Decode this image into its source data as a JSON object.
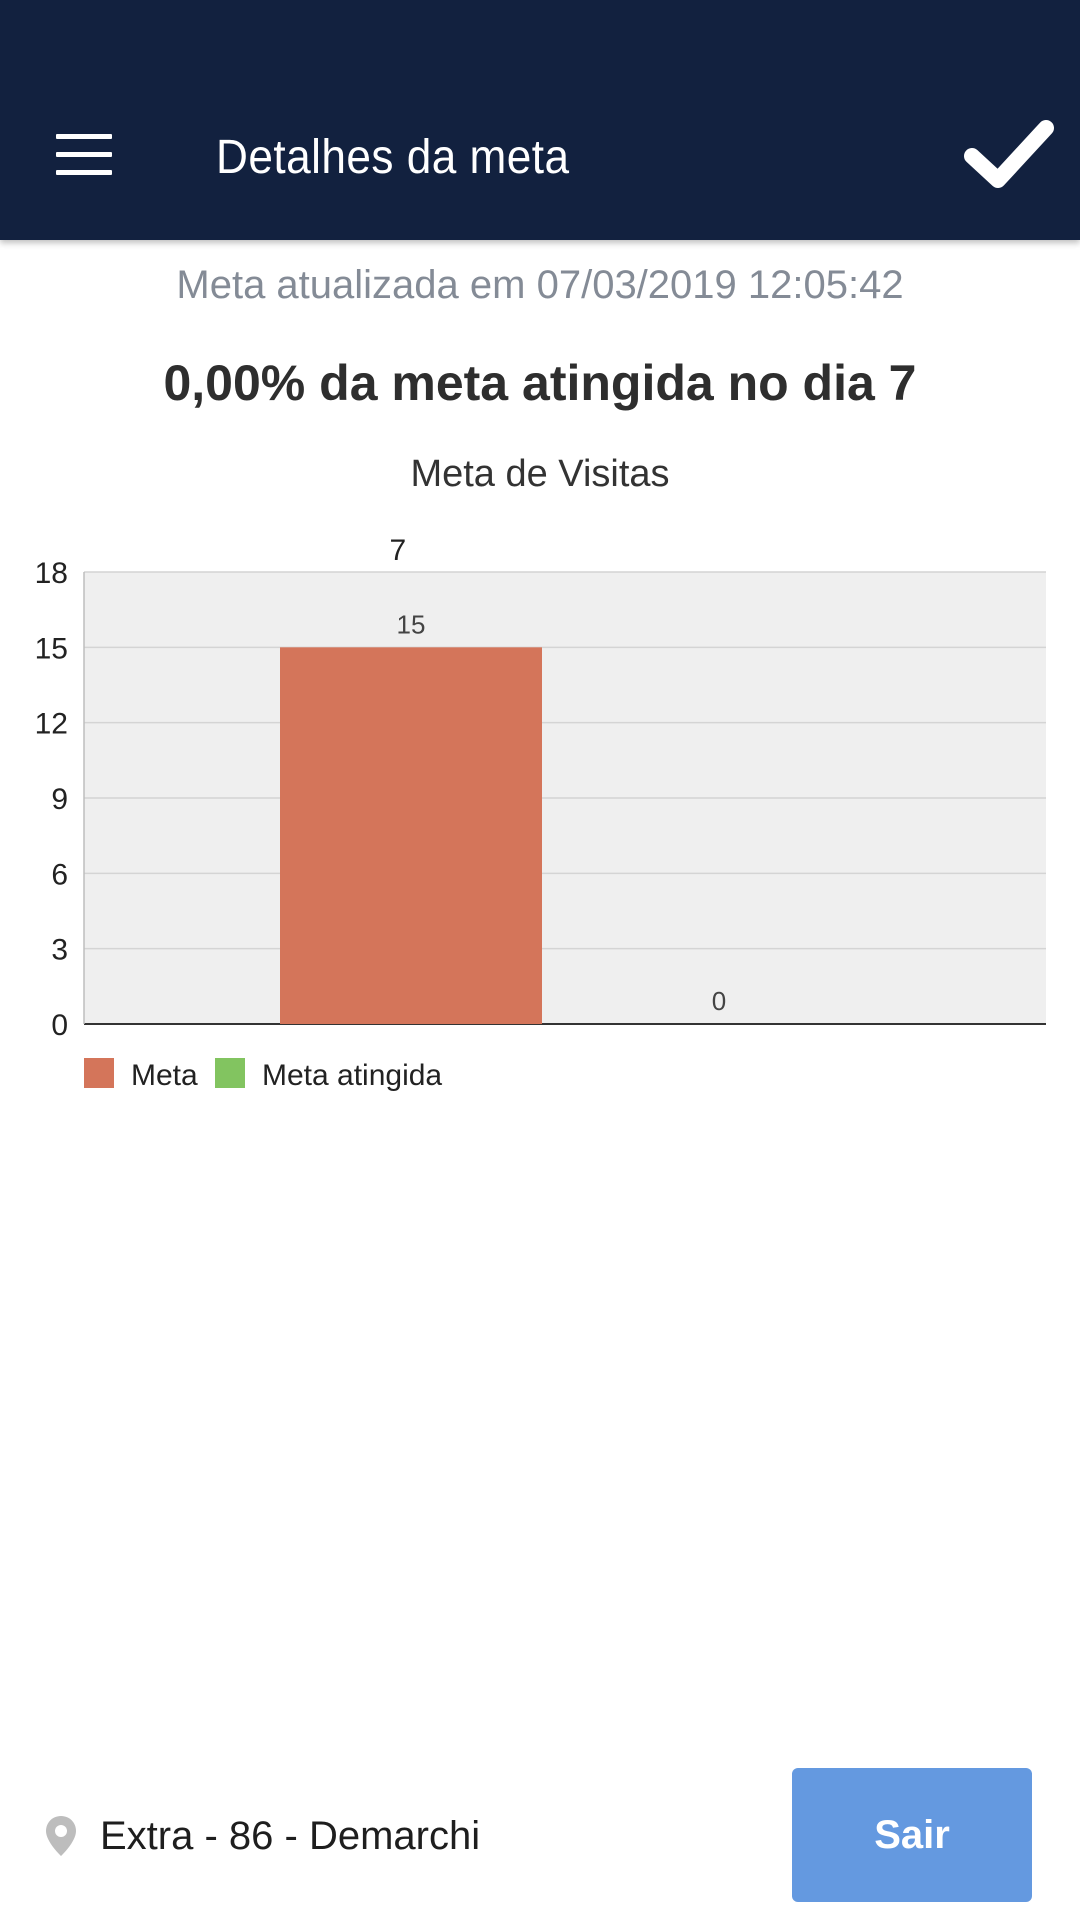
{
  "header": {
    "title": "Detalhes da meta",
    "menu_icon": "hamburger-menu-icon",
    "confirm_icon": "checkmark-icon",
    "background_color": "#12213f"
  },
  "content": {
    "updated_text": "Meta atualizada em 07/03/2019 12:05:42",
    "summary_text": "0,00% da meta atingida no dia 7"
  },
  "chart_data": {
    "type": "bar",
    "title": "Meta de Visitas",
    "categories": [
      "7"
    ],
    "series": [
      {
        "name": "Meta",
        "values": [
          15
        ],
        "color": "#d4755a"
      },
      {
        "name": "Meta atingida",
        "values": [
          0
        ],
        "color": "#82c460"
      }
    ],
    "ylim": [
      0,
      18
    ],
    "yticks": [
      0,
      3,
      6,
      9,
      12,
      15,
      18
    ],
    "grid": true,
    "plot_background": "#efefef",
    "legend": "bottom-left"
  },
  "footer": {
    "location_icon": "map-pin-icon",
    "location_text": "Extra - 86 - Demarchi",
    "exit_label": "Sair",
    "exit_color": "#6499e0"
  }
}
